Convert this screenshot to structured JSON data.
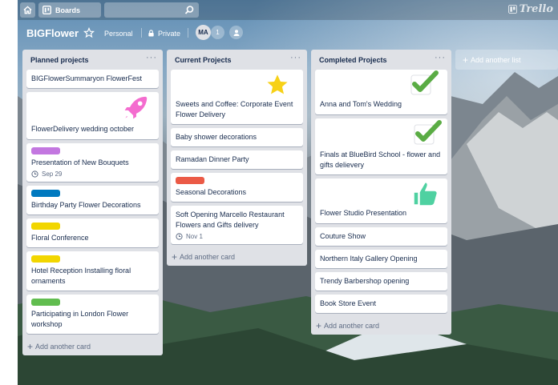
{
  "header": {
    "boards_label": "Boards",
    "search_placeholder": "",
    "logo_text": "Trello"
  },
  "board": {
    "title": "BIGFlower",
    "visibility_team": "Personal",
    "visibility_privacy": "Private",
    "member_initials": "MA",
    "member_count": "1"
  },
  "lists": [
    {
      "title": "Planned projects",
      "menu": "···",
      "add_card": "Add another card",
      "cards": [
        {
          "text": "BIGFlowerSummaryon FlowerFest"
        },
        {
          "text": "FlowerDelivery wedding october",
          "sticker": "rocket-sticker"
        },
        {
          "text": "Presentation of New Bouquets",
          "label_color": "#c377e0",
          "due": "Sep 29"
        },
        {
          "text": "Birthday Party Flower Decorations",
          "label_color": "#0079bf"
        },
        {
          "text": "Floral Conference",
          "label_color": "#f2d600"
        },
        {
          "text": "Hotel Reception Installing floral ornaments",
          "label_color": "#f2d600"
        },
        {
          "text": "Participating in London Flower workshop",
          "label_color": "#61bd4f"
        }
      ]
    },
    {
      "title": "Current Projects",
      "menu": "···",
      "add_card": "Add another card",
      "cards": [
        {
          "text": "Sweets and Coffee: Corporate Event Flower Delivery",
          "sticker": "star-sticker"
        },
        {
          "text": "Baby shower decorations"
        },
        {
          "text": "Ramadan Dinner Party"
        },
        {
          "text": "Seasonal Decorations",
          "label_color": "#eb5a46"
        },
        {
          "text": "Soft Opening Marcello Restaurant Flowers and Gifts delivery",
          "due": "Nov 1"
        }
      ]
    },
    {
      "title": "Completed Projects",
      "menu": "···",
      "add_card": "Add another card",
      "cards": [
        {
          "text": "Anna and Tom's Wedding",
          "sticker": "check-sticker"
        },
        {
          "text": "Finals at BlueBird School - flower and gifts delievery",
          "sticker": "check-sticker"
        },
        {
          "text": "Flower Studio Presentation",
          "sticker": "thumbs-up-sticker"
        },
        {
          "text": "Couture Show"
        },
        {
          "text": "Northern Italy Gallery Opening"
        },
        {
          "text": "Trendy Barbershop opening"
        },
        {
          "text": "Book Store Event"
        }
      ]
    }
  ],
  "add_list": "Add another list",
  "colors": {
    "list_bg": "#dfe1e6",
    "purple": "#c377e0",
    "blue": "#0079bf",
    "yellow": "#f2d600",
    "green": "#61bd4f",
    "red": "#eb5a46"
  }
}
